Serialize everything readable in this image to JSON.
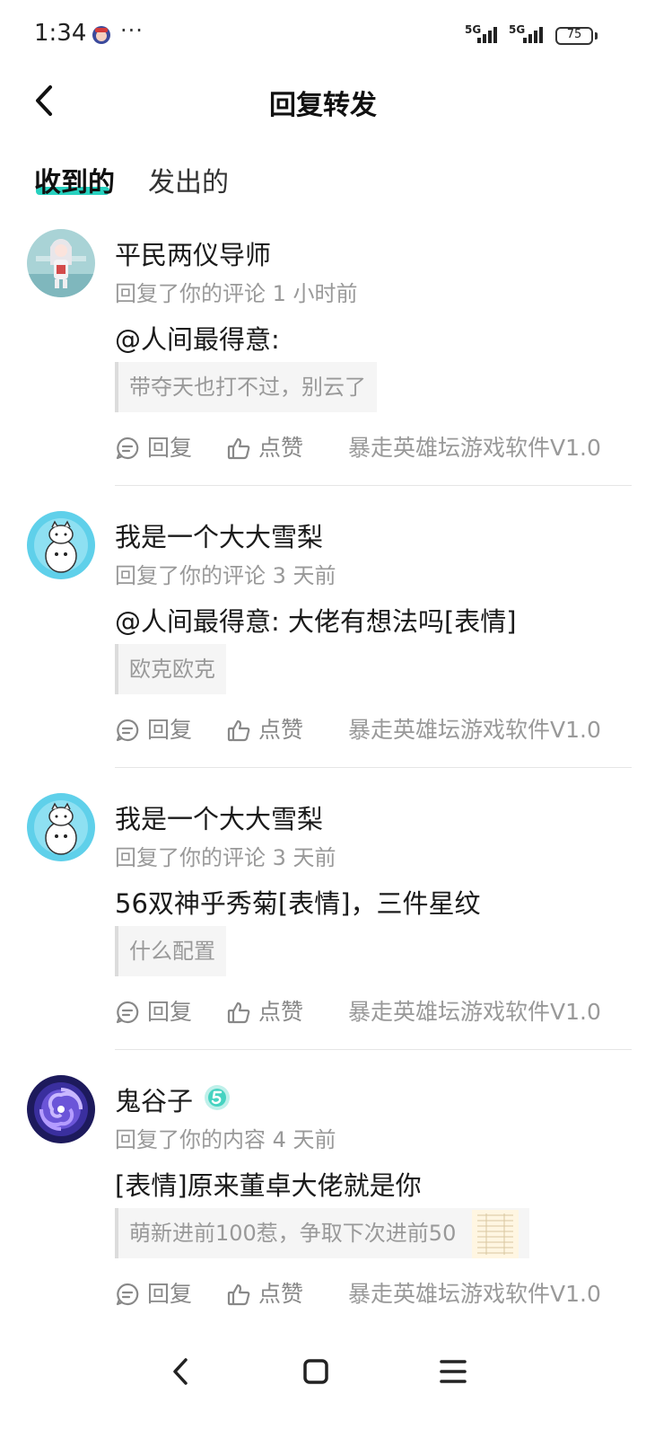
{
  "status_bar": {
    "time": "1:34",
    "more": "···",
    "network1": "5G",
    "network2": "5G",
    "battery": "75"
  },
  "header": {
    "title": "回复转发",
    "back_icon": "chevron-left-icon"
  },
  "tabs": [
    {
      "label": "收到的",
      "active": true
    },
    {
      "label": "发出的",
      "active": false
    }
  ],
  "accent_color": "#27d1bf",
  "items": [
    {
      "username": "平民两仪导师",
      "meta": "回复了你的评论 1 小时前",
      "content": "@人间最得意:",
      "quote": "带夺天也打不过，别云了",
      "reply_label": "回复",
      "like_label": "点赞",
      "source": "暴走英雄坛游戏软件V1.0"
    },
    {
      "username": "我是一个大大雪梨",
      "meta": "回复了你的评论 3 天前",
      "content": "@人间最得意: 大佬有想法吗[表情]",
      "quote": "欧克欧克",
      "reply_label": "回复",
      "like_label": "点赞",
      "source": "暴走英雄坛游戏软件V1.0"
    },
    {
      "username": "我是一个大大雪梨",
      "meta": "回复了你的评论 3 天前",
      "content": "56双神乎秀菊[表情]，三件星纹",
      "quote": "什么配置",
      "reply_label": "回复",
      "like_label": "点赞",
      "source": "暴走英雄坛游戏软件V1.0"
    },
    {
      "username": "鬼谷子",
      "meta": "回复了你的内容 4 天前",
      "content": "[表情]原来董卓大佬就是你",
      "quote": "萌新进前100惹，争取下次进前50",
      "reply_label": "回复",
      "like_label": "点赞",
      "source": "暴走英雄坛游戏软件V1.0"
    }
  ]
}
